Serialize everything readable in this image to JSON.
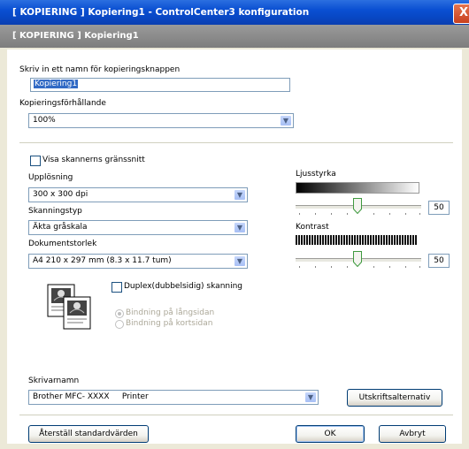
{
  "window": {
    "title": "[ KOPIERING ]  Kopiering1 - ControlCenter3 konfiguration",
    "close_glyph": "X"
  },
  "header": {
    "title": "[ KOPIERING ]  Kopiering1"
  },
  "name_section": {
    "label": "Skriv in ett namn för kopieringsknappen",
    "value": "Kopiering1"
  },
  "ratio": {
    "label": "Kopieringsförhållande",
    "value": "100%"
  },
  "show_scanner_ui": {
    "label": "Visa skannerns gränssnitt",
    "checked": false
  },
  "resolution": {
    "label": "Upplösning",
    "value": "300 x 300 dpi"
  },
  "scan_type": {
    "label": "Skanningstyp",
    "value": "Äkta gråskala"
  },
  "doc_size": {
    "label": "Dokumentstorlek",
    "value": "A4 210 x 297 mm (8.3 x 11.7 tum)"
  },
  "brightness": {
    "label": "Ljusstyrka",
    "value": "50"
  },
  "contrast": {
    "label": "Kontrast",
    "value": "50"
  },
  "duplex": {
    "label": "Duplex(dubbelsidig) skanning",
    "checked": false,
    "options": [
      "Bindning på långsidan",
      "Bindning på kortsidan"
    ],
    "selected": 0
  },
  "printer": {
    "label": "Skrivarnamn",
    "value": "Brother MFC- XXXX     Printer",
    "options_button": "Utskriftsalternativ"
  },
  "footer": {
    "reset": "Återställ standardvärden",
    "ok": "OK",
    "cancel": "Avbryt"
  },
  "colors": {
    "title_bar": "#0a4fd2",
    "header": "#8a8a8a",
    "selection": "#316ac5"
  }
}
